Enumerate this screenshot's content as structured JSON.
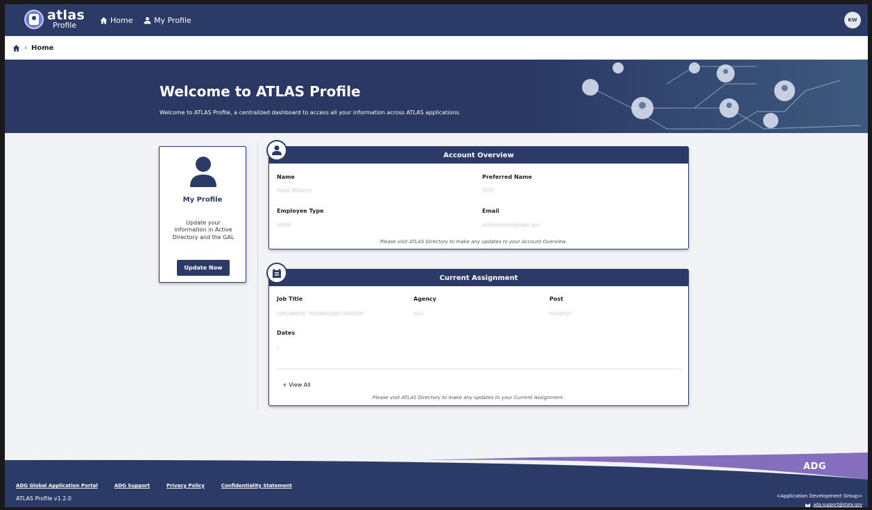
{
  "nav": {
    "logo_main": "atlas",
    "logo_sub": "Profile",
    "home": "Home",
    "my_profile": "My Profile",
    "avatar_initials": "KW"
  },
  "breadcrumb": {
    "current": "Home"
  },
  "hero": {
    "title": "Welcome to ATLAS Profile",
    "subtitle": "Welcome to ATLAS Profile, a centralized dashboard to access all your information across ATLAS applications."
  },
  "profile_card": {
    "title": "My Profile",
    "description": "Update your information in Active Directory and the GAL",
    "button": "Update Now"
  },
  "account_overview": {
    "title": "Account Overview",
    "fields": {
      "name_label": "Name",
      "name_value": "Kayla Williams",
      "preferred_label": "Preferred Name",
      "preferred_value": "TEST",
      "type_label": "Employee Type",
      "type_value": "USDH",
      "email_label": "Email",
      "email_value": "williamskm2@state.gov"
    },
    "note": "Please visit ATLAS Directory to make any updates to your Account Overview."
  },
  "current_assignment": {
    "title": "Current Assignment",
    "fields": {
      "job_label": "Job Title",
      "job_value": "DIPLOMATIC TECHNOLOGY OFFICER",
      "agency_label": "Agency",
      "agency_value": "SUS",
      "post_label": "Post",
      "post_value": "Frankfurt",
      "dates_label": "Dates",
      "dates_value": "-"
    },
    "view_all": "+ View All",
    "note": "Please visit ATLAS Directory to make any updates to your Current Assignment."
  },
  "footer": {
    "links": [
      "ADG Global Application Portal",
      "ADG Support",
      "Privacy Policy",
      "Confidentiality Statement"
    ],
    "version": "ATLAS Profile v1.2.0",
    "adg_logo": "ADG",
    "adg_sub": "<Application Development Group>",
    "adg_email": "adg-support@state.gov"
  }
}
